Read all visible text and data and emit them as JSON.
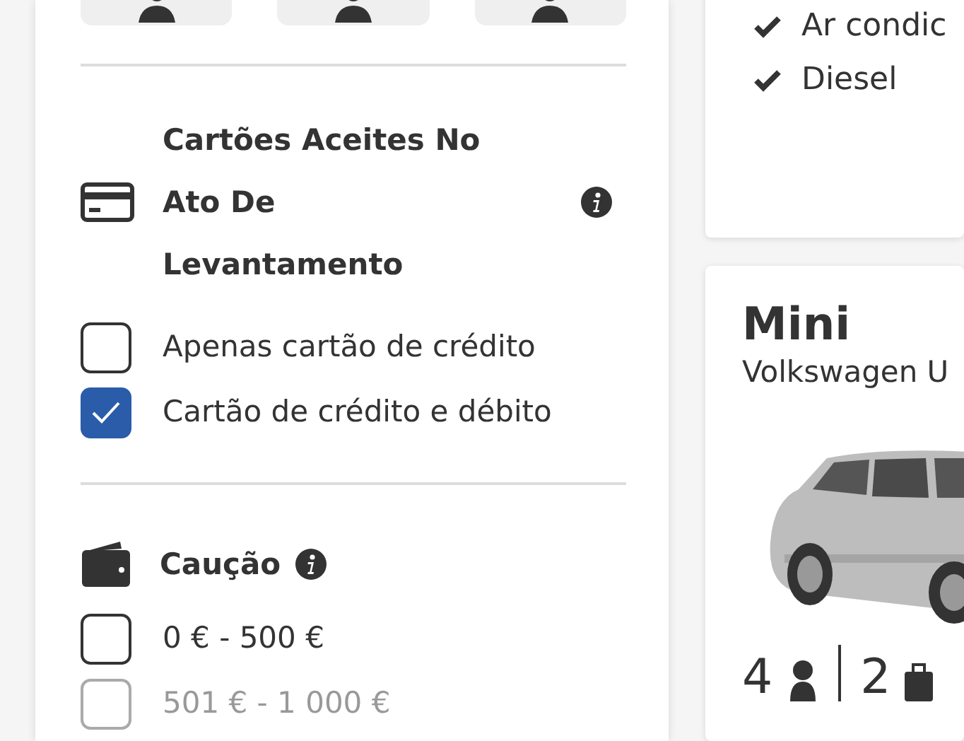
{
  "seat_chips": [
    {
      "kind": "seats"
    },
    {
      "kind": "seats"
    },
    {
      "kind": "seats"
    }
  ],
  "card_filter": {
    "title": "Cartões Aceites No Ato De Levantamento",
    "options": [
      {
        "label": "Apenas cartão de crédito",
        "checked": false,
        "disabled": false
      },
      {
        "label": "Cartão de crédito e débito",
        "checked": true,
        "disabled": false
      }
    ]
  },
  "deposit_filter": {
    "title": "Caução",
    "options": [
      {
        "label": "0 € - 500 €",
        "checked": false,
        "disabled": false
      },
      {
        "label": "501 € - 1 000 €",
        "checked": false,
        "disabled": true
      }
    ]
  },
  "features": [
    "Ar condic",
    "Diesel"
  ],
  "car": {
    "category": "Mini",
    "model": "Volkswagen U",
    "seats": "4",
    "bags": "2"
  }
}
